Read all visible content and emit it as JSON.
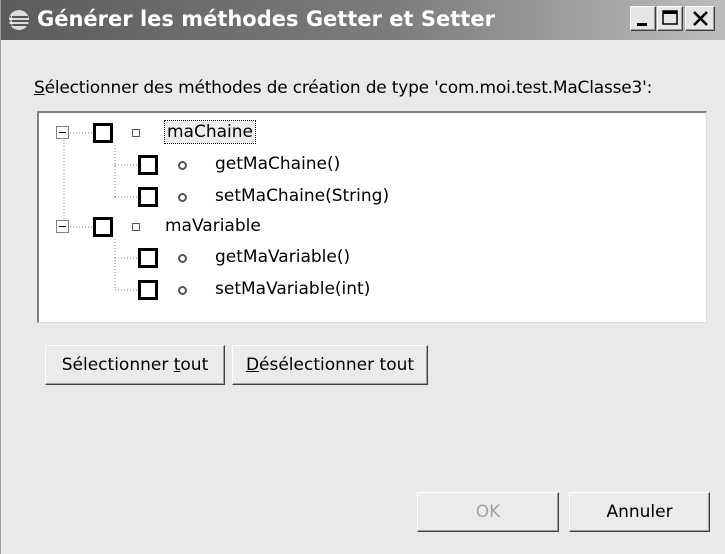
{
  "window": {
    "title": "Générer les méthodes Getter et Setter"
  },
  "prompt": {
    "accel": "S",
    "rest": "électionner des méthodes de création de type 'com.moi.test.MaClasse3':"
  },
  "tree": {
    "nodes": [
      {
        "label": "maChaine",
        "kind": "field",
        "checked": false,
        "expanded": true,
        "selected": true
      },
      {
        "label": "getMaChaine()",
        "kind": "method",
        "checked": false
      },
      {
        "label": "setMaChaine(String)",
        "kind": "method",
        "checked": false
      },
      {
        "label": "maVariable",
        "kind": "field",
        "checked": false,
        "expanded": true
      },
      {
        "label": "getMaVariable()",
        "kind": "method",
        "checked": false
      },
      {
        "label": "setMaVariable(int)",
        "kind": "method",
        "checked": false
      }
    ]
  },
  "buttons": {
    "select_all": {
      "before": "Sélectionner ",
      "accel": "t",
      "after": "out"
    },
    "deselect_all": {
      "before": "",
      "accel": "D",
      "after": "ésélectionner tout"
    },
    "ok": "OK",
    "cancel": "Annuler"
  },
  "icons": {
    "app": "eclipse-icon",
    "minimize": "minimize-icon",
    "maximize": "maximize-icon",
    "close": "close-icon",
    "expander": "collapse-minus-icon",
    "field": "field-square-icon",
    "method": "method-circle-icon"
  }
}
